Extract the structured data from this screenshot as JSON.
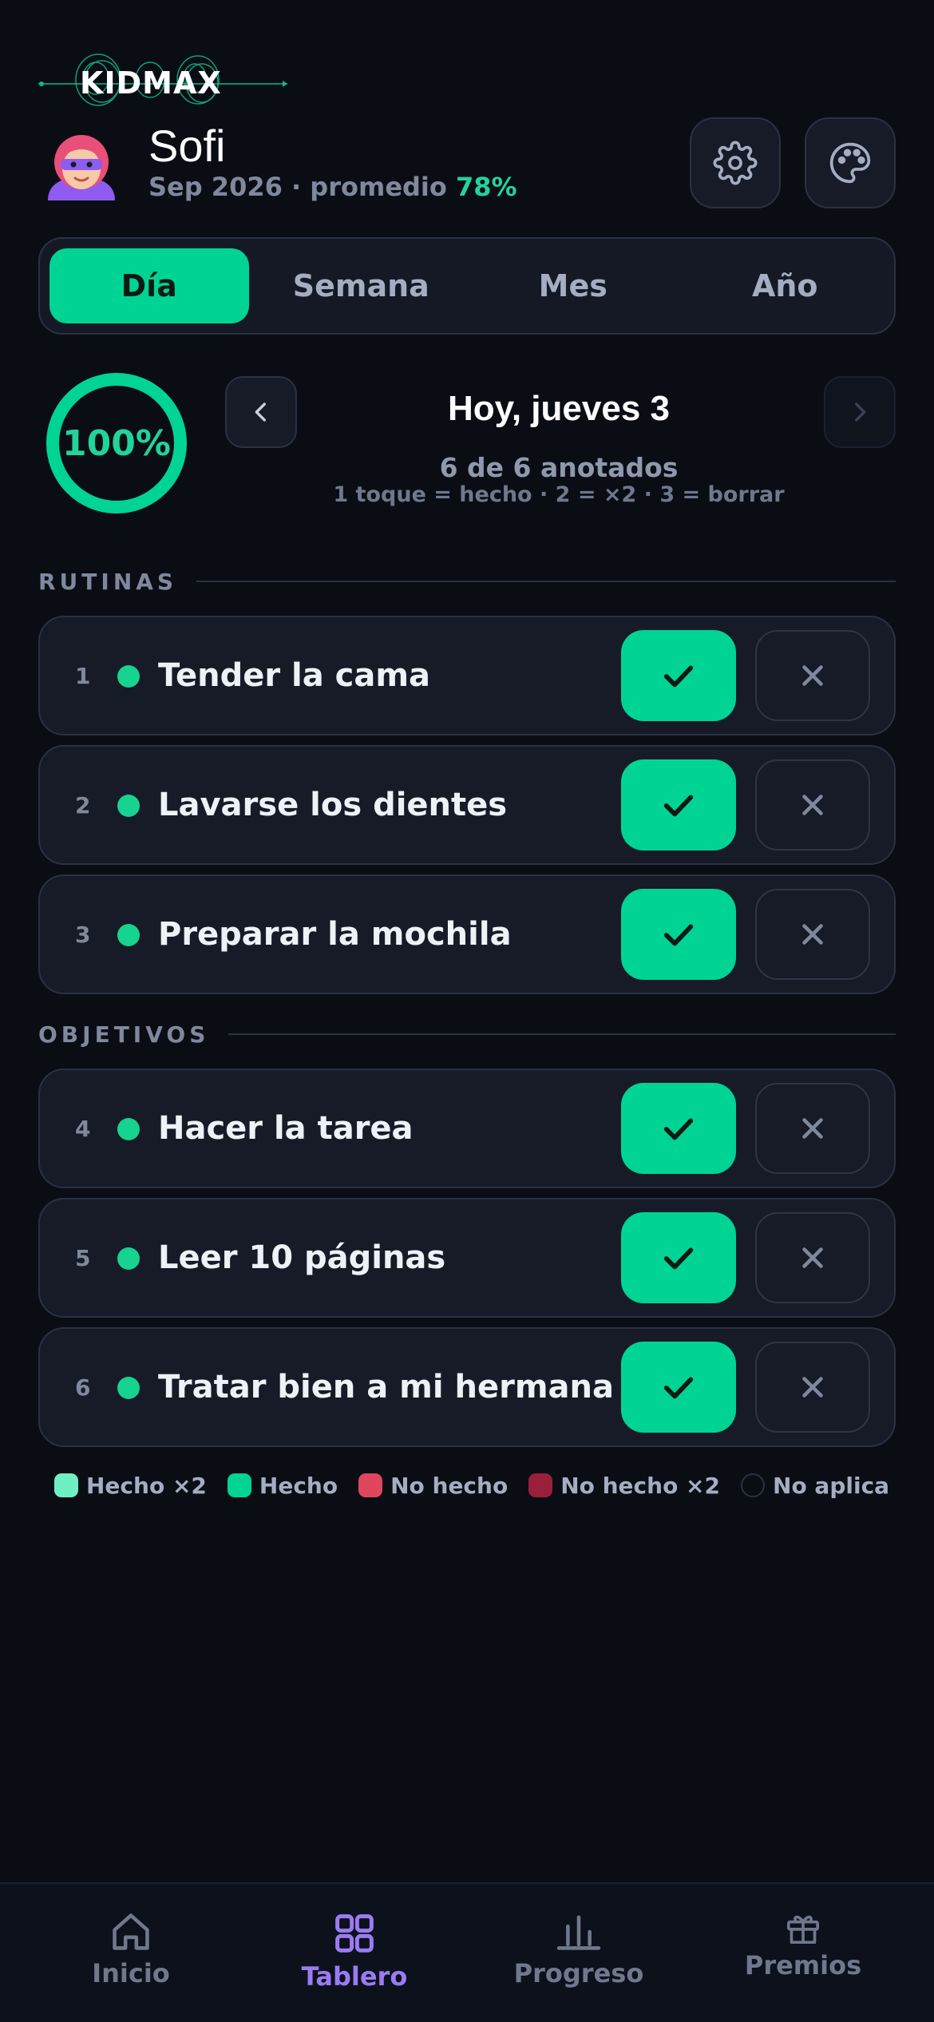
{
  "app": {
    "logo_text": "KIDMAX"
  },
  "profile": {
    "name": "Sofi",
    "subtitle": "Sep 2026 · promedio",
    "average": "78%"
  },
  "header": {
    "settings_icon": "gear-icon",
    "theme_icon": "palette-icon"
  },
  "tabs": [
    {
      "label": "Día",
      "active": true
    },
    {
      "label": "Semana",
      "active": false
    },
    {
      "label": "Mes",
      "active": false
    },
    {
      "label": "Año",
      "active": false
    }
  ],
  "day": {
    "progress_label": "100%",
    "progress": 1.0,
    "title": "Hoy, jueves 3",
    "count": "6 de 6 anotados",
    "hint": "1 toque = hecho · 2 = ×2 · 3 = borrar"
  },
  "sections": [
    {
      "label": "RUTINAS",
      "tasks": [
        {
          "num": "1",
          "title": "Tender la cama"
        },
        {
          "num": "2",
          "title": "Lavarse los dientes"
        },
        {
          "num": "3",
          "title": "Preparar la mochila"
        }
      ]
    },
    {
      "label": "OBJETIVOS",
      "tasks": [
        {
          "num": "4",
          "title": "Hacer la tarea"
        },
        {
          "num": "5",
          "title": "Leer 10 páginas"
        },
        {
          "num": "6",
          "title": "Tratar bien a mi hermana"
        }
      ]
    }
  ],
  "legend": [
    {
      "label": "Hecho ×2",
      "color": "#6ff0c4"
    },
    {
      "label": "Hecho",
      "color": "#00d494"
    },
    {
      "label": "No hecho",
      "color": "#e0465e"
    },
    {
      "label": "No hecho ×2",
      "color": "#9a1f3a"
    },
    {
      "label": "No aplica",
      "color": "#0a0d14"
    }
  ],
  "bottom_nav": [
    {
      "label": "Inicio",
      "icon": "home-icon",
      "active": false
    },
    {
      "label": "Tablero",
      "icon": "grid-icon",
      "active": true
    },
    {
      "label": "Progreso",
      "icon": "chart-icon",
      "active": false
    },
    {
      "label": "Premios",
      "icon": "gift-icon",
      "active": false
    }
  ],
  "colors": {
    "accent": "#00d494",
    "active_nav": "#9b7bf2",
    "background": "#0a0d14"
  }
}
